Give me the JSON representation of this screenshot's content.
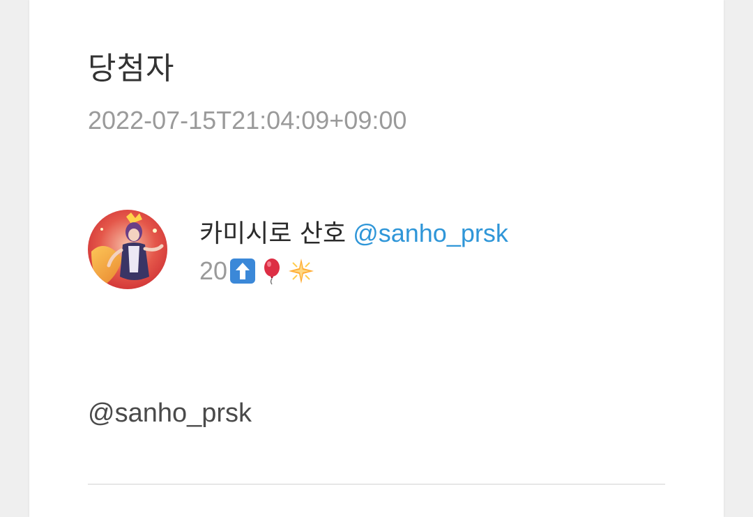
{
  "post": {
    "title": "당첨자",
    "timestamp": "2022-07-15T21:04:09+09:00",
    "author": {
      "display_name": "카미시로 산호",
      "handle": "@sanho_prsk",
      "avatar_icon": "avatar-image",
      "bio_number": "20",
      "bio_emojis": [
        "up-arrow-icon",
        "red-balloon-icon",
        "sparkle-star-icon"
      ]
    },
    "mention": "@sanho_prsk"
  },
  "colors": {
    "link": "#2f96d8",
    "muted_text": "#9a9a9a",
    "body_text": "#333333",
    "background": "#efefef",
    "card": "#ffffff"
  }
}
